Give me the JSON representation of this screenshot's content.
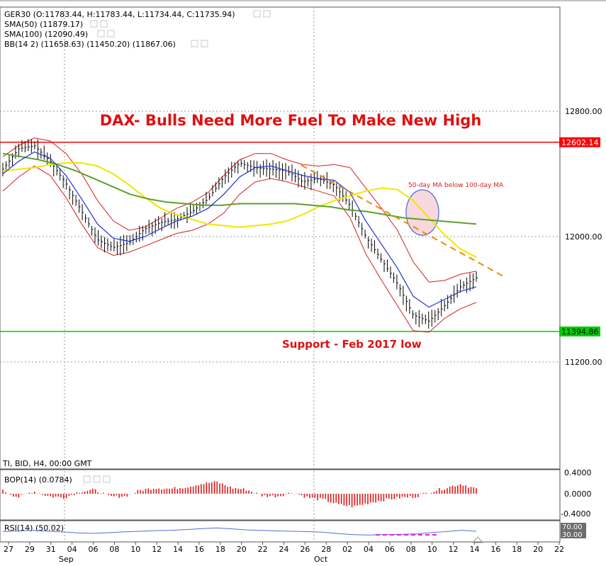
{
  "chart_data": {
    "type": "line",
    "instrument_header": "GER30 (O:11783.44, H:11783.44, L:11734.44, C:11735.94)",
    "title": "DAX- Bulls Need More Fuel To Make New High",
    "indicators": [
      {
        "label": "SMA(50) (11879.17)",
        "color": "#f0e600"
      },
      {
        "label": "SMA(100) (12090.49)",
        "color": "#5aa02c"
      },
      {
        "label": "BB(14 2) (11658.63) (11450.20) (11867.06)",
        "color": "#d42020"
      }
    ],
    "timeframe_label": "TI, BID, H4, 00:00 GMT",
    "y_axis": {
      "ticks": [
        "12800.00",
        "12000.00",
        "11200.00"
      ],
      "ylim": [
        11200,
        12800
      ]
    },
    "x_axis": {
      "ticks": [
        "27",
        "29",
        "31",
        "04",
        "06",
        "08",
        "10",
        "12",
        "14",
        "16",
        "18",
        "20",
        "22",
        "24",
        "26",
        "28",
        "02",
        "04",
        "06",
        "08",
        "10",
        "12",
        "14",
        "16",
        "18",
        "20",
        "22"
      ],
      "month_labels": [
        "Sep",
        "Oct"
      ]
    },
    "levels": [
      {
        "name": "resistance",
        "value": 12602.14,
        "label": "12602.14",
        "color": "#ff0000"
      },
      {
        "name": "support",
        "value": 11394.86,
        "label": "11394.86",
        "color": "#00cc00"
      }
    ],
    "annotations": {
      "ma_cross": "50-day MA below 100-day MA",
      "support": "Support - Feb 2017 low"
    },
    "series": [
      {
        "name": "SMA(50)",
        "color": "#f0e600",
        "values": [
          12420,
          12430,
          12440,
          12460,
          12470,
          12470,
          12450,
          12400,
          12330,
          12250,
          12180,
          12140,
          12110,
          12080,
          12070,
          12060,
          12070,
          12080,
          12100,
          12140,
          12190,
          12230,
          12260,
          12290,
          12310,
          12300,
          12230,
          12120,
          12010,
          11920,
          11870
        ]
      },
      {
        "name": "SMA(100)",
        "color": "#5aa02c",
        "values": [
          12530,
          12510,
          12490,
          12460,
          12420,
          12370,
          12320,
          12270,
          12240,
          12220,
          12210,
          12200,
          12200,
          12210,
          12210,
          12210,
          12210,
          12200,
          12190,
          12170,
          12160,
          12140,
          12120,
          12110,
          12100,
          12090,
          12080
        ]
      },
      {
        "name": "Middle band",
        "color": "#2030d0",
        "values": [
          12400,
          12480,
          12540,
          12500,
          12390,
          12240,
          12080,
          11990,
          11970,
          12000,
          12050,
          12100,
          12130,
          12180,
          12270,
          12380,
          12440,
          12450,
          12420,
          12390,
          12370,
          12360,
          12280,
          12100,
          11950,
          11800,
          11620,
          11550,
          11600,
          11650,
          11680
        ]
      },
      {
        "name": "Close",
        "color": "#000000",
        "values": [
          12430,
          12560,
          12580,
          12480,
          12340,
          12160,
          11980,
          11930,
          11960,
          12050,
          12090,
          12110,
          12160,
          12240,
          12380,
          12470,
          12440,
          12430,
          12420,
          12350,
          12370,
          12330,
          12200,
          12000,
          11850,
          11700,
          11500,
          11460,
          11560,
          11680,
          11736
        ]
      }
    ],
    "bop": {
      "label": "BOP(14) (0.0784)",
      "ticks": [
        "0.4000",
        "0.0000",
        "-0.4000"
      ],
      "ylim": [
        -0.4,
        0.4
      ],
      "values": [
        0.06,
        -0.07,
        0.05,
        -0.05,
        -0.08,
        0.04,
        0.08,
        -0.06,
        -0.05,
        0.07,
        0.12,
        0.1,
        0.14,
        0.2,
        0.24,
        0.12,
        0.08,
        -0.04,
        -0.05,
        0.03,
        -0.08,
        -0.12,
        -0.22,
        -0.26,
        -0.18,
        -0.12,
        -0.08,
        -0.06,
        0.04,
        0.12,
        0.2,
        0.1
      ]
    },
    "rsi": {
      "label": "RSI(14) (50.02)",
      "ticks": [
        "70.00",
        "30.00"
      ],
      "ylim": [
        0,
        100
      ],
      "values": [
        48,
        52,
        55,
        50,
        46,
        40,
        38,
        42,
        47,
        50,
        54,
        56,
        60,
        66,
        70,
        64,
        58,
        55,
        52,
        50,
        48,
        44,
        36,
        30,
        28,
        30,
        32,
        34,
        42,
        48,
        56,
        50
      ]
    }
  }
}
